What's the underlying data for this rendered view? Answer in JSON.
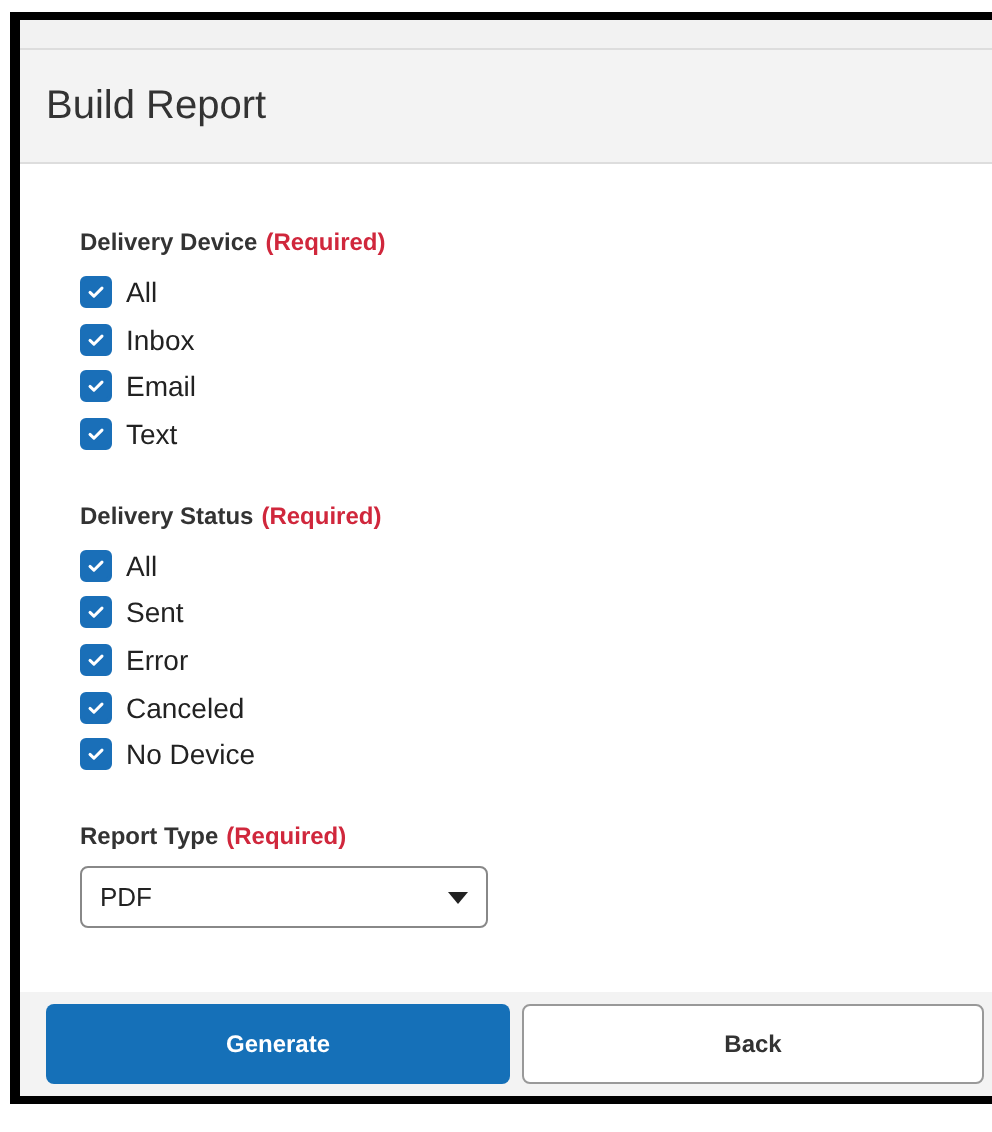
{
  "header": {
    "title": "Build Report"
  },
  "sections": [
    {
      "kind": "checkboxes",
      "label": "Delivery Device",
      "note": "(Required)",
      "options": [
        {
          "label": "All",
          "checked": true
        },
        {
          "label": "Inbox",
          "checked": true
        },
        {
          "label": "Email",
          "checked": true
        },
        {
          "label": "Text",
          "checked": true
        }
      ]
    },
    {
      "kind": "checkboxes",
      "label": "Delivery Status",
      "note": "(Required)",
      "options": [
        {
          "label": "All",
          "checked": true
        },
        {
          "label": "Sent",
          "checked": true
        },
        {
          "label": "Error",
          "checked": true
        },
        {
          "label": "Canceled",
          "checked": true
        },
        {
          "label": "No Device",
          "checked": true
        }
      ]
    },
    {
      "kind": "select",
      "label": "Report Type",
      "note": "(Required)",
      "value": "PDF"
    }
  ],
  "buttons": [
    {
      "label": "Generate",
      "kind": "primary"
    },
    {
      "label": "Back",
      "kind": "secondary"
    }
  ]
}
